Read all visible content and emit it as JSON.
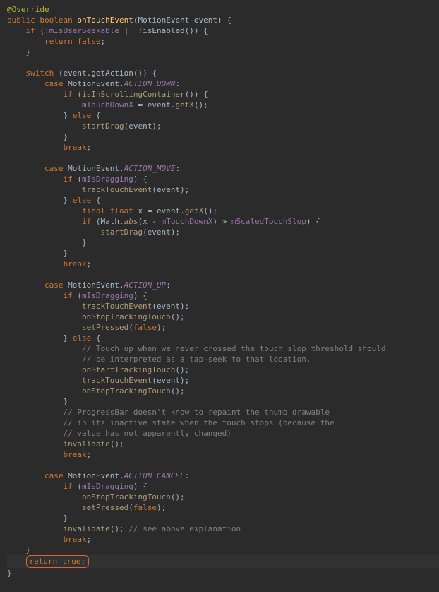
{
  "ann": "@Override",
  "l1a": "public",
  "l1b": "boolean",
  "l1c": "onTouchEvent",
  "l1d": "(MotionEvent event) {",
  "l2a": "if",
  "l2b": " (!",
  "l2c": "mIsUserSeekable",
  "l2d": " || !isEnabled()) {",
  "l3a": "return ",
  "l3b": "false",
  "l3c": ";",
  "rb": "}",
  "l5a": "switch",
  "l5b": " (event.getAction()) {",
  "l6a": "case",
  "l6b": " MotionEvent.",
  "l6c": "ACTION_DOWN",
  "l6d": ":",
  "l7a": "if",
  "l7b": " (",
  "l7c": "isInScrollingContainer",
  "l7d": "()) {",
  "l8a": "mTouchDownX",
  "l8b": " = event.",
  "l8c": "getX",
  "l8d": "();",
  "l9a": "} ",
  "l9b": "else",
  "l9c": " {",
  "l10a": "startDrag",
  "l10b": "(event);",
  "l12a": "break",
  "l12b": ";",
  "l13c": "ACTION_MOVE",
  "l14a": "if",
  "l14b": " (",
  "l14c": "mIsDragging",
  "l14d": ") {",
  "l15a": "trackTouchEvent",
  "l15b": "(event);",
  "l17a": "final ",
  "l17b": "float",
  "l17c": " x = event.",
  "l17d": "getX",
  "l17e": "();",
  "l18a": "if",
  "l18b": " (Math.",
  "l18c": "abs",
  "l18d": "(x - ",
  "l18e": "mTouchDownX",
  "l18f": ") > ",
  "l18g": "mScaledTouchSlop",
  "l18h": ") {",
  "l19a": "startDrag",
  "l19b": "(event);",
  "l24c": "ACTION_UP",
  "l27a": "onStopTrackingTouch",
  "l27b": "();",
  "l28a": "setPressed",
  "l28b": "(",
  "l28c": "false",
  "l28d": ");",
  "l30": "// Touch up when we never crossed the touch slop threshold should",
  "l31": "// be interpreted as a tap-seek to that location.",
  "l32a": "onStartTrackingTouch",
  "l32b": "();",
  "l36": "// ProgressBar doesn't know to repaint the thumb drawable",
  "l37": "// in its inactive state when the touch stops (because the",
  "l38": "// value has not apparently changed)",
  "l39a": "invalidate",
  "l39b": "();",
  "l42c": "ACTION_CANCEL",
  "l47": "// see above explanation",
  "l49a": "return ",
  "l49b": "true",
  "l49c": ";"
}
